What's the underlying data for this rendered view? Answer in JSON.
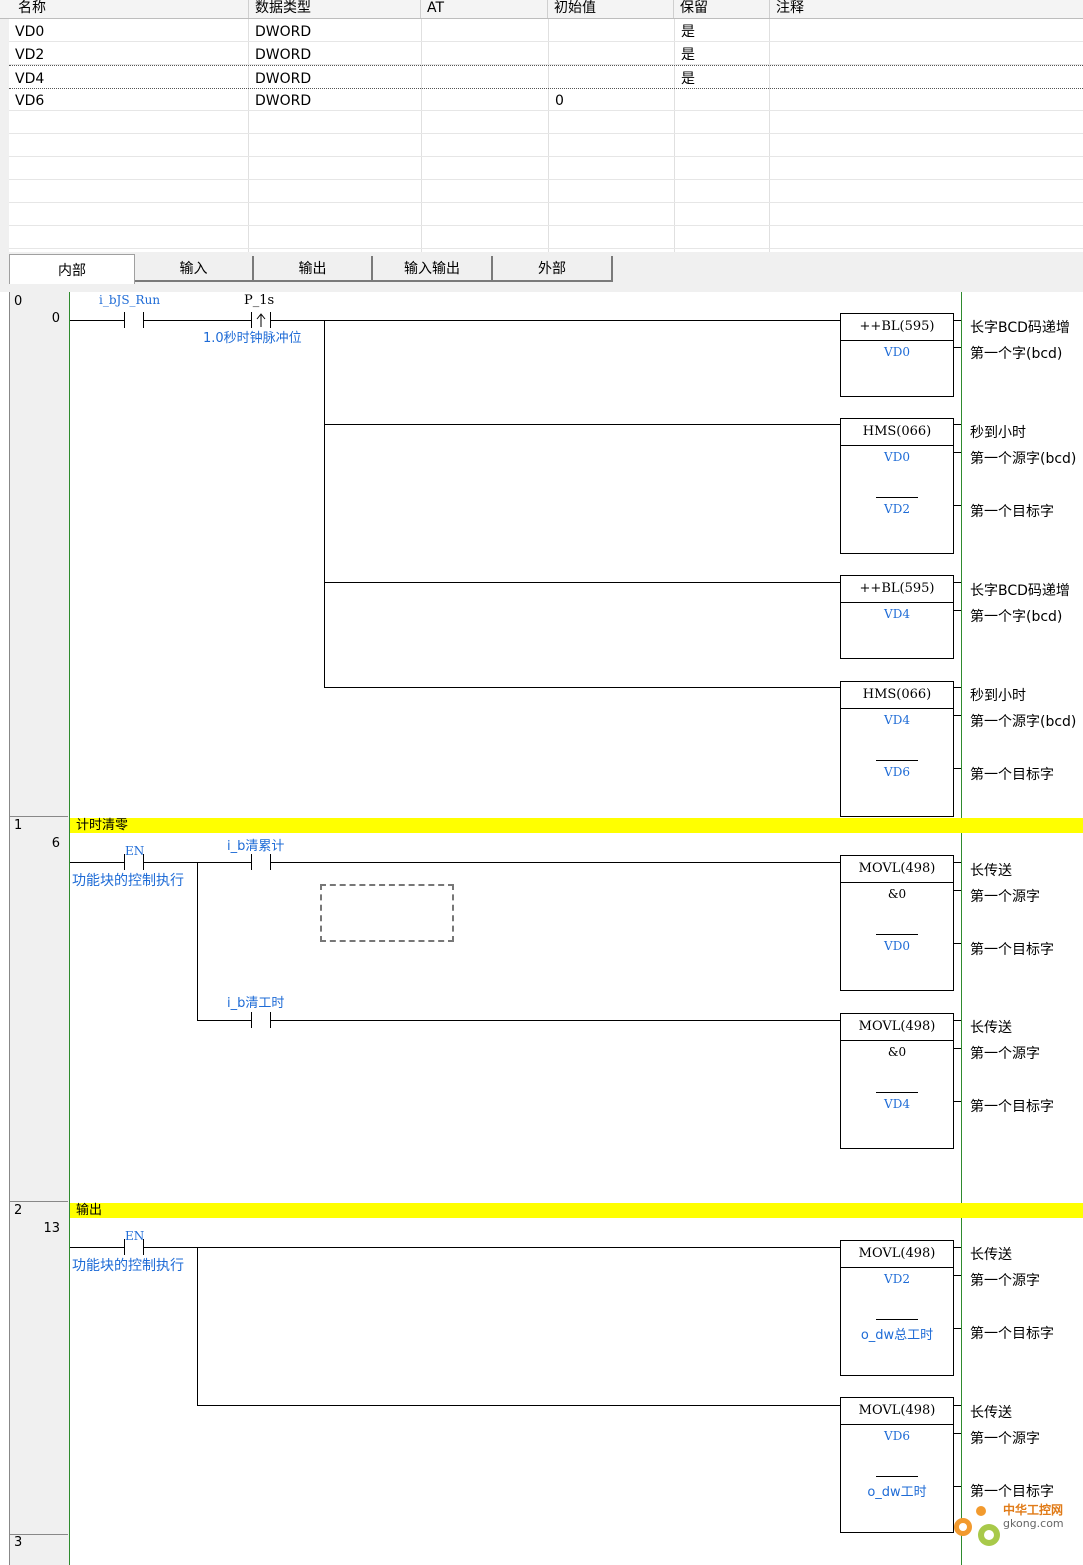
{
  "var_table": {
    "columns": [
      "名称",
      "数据类型",
      "AT",
      "初始值",
      "保留",
      "注释"
    ],
    "rows": [
      {
        "name": "VD0",
        "type": "DWORD",
        "at": "",
        "init": "",
        "retain": "是",
        "comment": ""
      },
      {
        "name": "VD2",
        "type": "DWORD",
        "at": "",
        "init": "",
        "retain": "是",
        "comment": ""
      },
      {
        "name": "VD4",
        "type": "DWORD",
        "at": "",
        "init": "",
        "retain": "是",
        "comment": ""
      },
      {
        "name": "VD6",
        "type": "DWORD",
        "at": "",
        "init": "0",
        "retain": "",
        "comment": ""
      }
    ],
    "selected_row": 2
  },
  "tabs": [
    "内部",
    "输入",
    "输出",
    "输入输出",
    "外部"
  ],
  "active_tab": 0,
  "ladder": {
    "rung0": {
      "rung": "0",
      "step": "0",
      "contact1": "i_bJS_Run",
      "contact2": "P_1s",
      "contact2_comment": "1.0秒时钟脉冲位",
      "blocks": [
        {
          "title": "++BL(595)",
          "op1": "VD0",
          "c_title": "长字BCD码递增",
          "c_op1": "第一个字(bcd)"
        },
        {
          "title": "HMS(066)",
          "op1": "VD0",
          "op2": "VD2",
          "c_title": "秒到小时",
          "c_op1": "第一个源字(bcd)",
          "c_op2": "第一个目标字"
        },
        {
          "title": "++BL(595)",
          "op1": "VD4",
          "c_title": "长字BCD码递增",
          "c_op1": "第一个字(bcd)"
        },
        {
          "title": "HMS(066)",
          "op1": "VD4",
          "op2": "VD6",
          "c_title": "秒到小时",
          "c_op1": "第一个源字(bcd)",
          "c_op2": "第一个目标字"
        }
      ]
    },
    "rung1": {
      "rung": "1",
      "step": "6",
      "comment": "计时清零",
      "en": "EN",
      "en_comment": "功能块的控制执行",
      "contact1": "i_b清累计",
      "contact2": "i_b清工时",
      "blocks": [
        {
          "title": "MOVL(498)",
          "op1": "&0",
          "op2": "VD0",
          "c_title": "长传送",
          "c_op1": "第一个源字",
          "c_op2": "第一个目标字"
        },
        {
          "title": "MOVL(498)",
          "op1": "&0",
          "op2": "VD4",
          "c_title": "长传送",
          "c_op1": "第一个源字",
          "c_op2": "第一个目标字"
        }
      ]
    },
    "rung2": {
      "rung": "2",
      "step": "13",
      "comment": "输出",
      "en": "EN",
      "en_comment": "功能块的控制执行",
      "blocks": [
        {
          "title": "MOVL(498)",
          "op1": "VD2",
          "op2": "o_dw总工时",
          "c_title": "长传送",
          "c_op1": "第一个源字",
          "c_op2": "第一个目标字"
        },
        {
          "title": "MOVL(498)",
          "op1": "VD6",
          "op2": "o_dw工时",
          "c_title": "长传送",
          "c_op1": "第一个源字",
          "c_op2": "第一个目标字"
        }
      ]
    },
    "rung3": {
      "rung": "3"
    }
  },
  "watermark": {
    "text": "中华工控网",
    "domain": "gkong.com"
  }
}
